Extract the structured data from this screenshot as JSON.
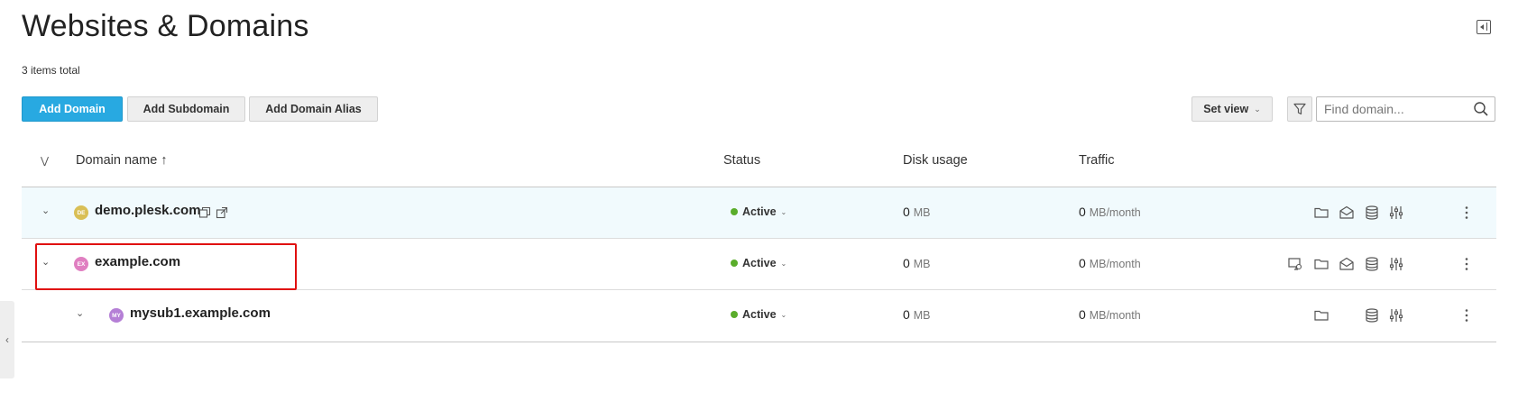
{
  "page": {
    "title": "Websites & Domains",
    "items_total": "3 items total"
  },
  "toolbar": {
    "add_domain": "Add Domain",
    "add_subdomain": "Add Subdomain",
    "add_domain_alias": "Add Domain Alias",
    "set_view": "Set view",
    "search_placeholder": "Find domain..."
  },
  "table": {
    "columns": {
      "domain_name": "Domain name ↑",
      "status": "Status",
      "disk_usage": "Disk usage",
      "traffic": "Traffic"
    },
    "rows": [
      {
        "favicon": "DE",
        "favicon_color": "#d9bf56",
        "name": "demo.plesk.com",
        "status": "Active",
        "disk_value": "0",
        "disk_unit": "MB",
        "traffic_value": "0",
        "traffic_unit": "MB/month",
        "icons": [
          "copy-icon",
          "open-external-icon",
          "folder-icon",
          "mail-icon",
          "database-icon",
          "settings-sliders-icon",
          "more-icon"
        ]
      },
      {
        "favicon": "EX",
        "favicon_color": "#e07fc1",
        "name": "example.com",
        "status": "Active",
        "disk_value": "0",
        "disk_unit": "MB",
        "traffic_value": "0",
        "traffic_unit": "MB/month",
        "icons": [
          "preview-icon",
          "folder-icon",
          "mail-icon",
          "database-icon",
          "settings-sliders-icon",
          "more-icon"
        ]
      },
      {
        "favicon": "MY",
        "favicon_color": "#b57fd6",
        "name": "mysub1.example.com",
        "status": "Active",
        "disk_value": "0",
        "disk_unit": "MB",
        "traffic_value": "0",
        "traffic_unit": "MB/month",
        "icons": [
          "folder-icon",
          "database-icon",
          "settings-sliders-icon",
          "more-icon"
        ]
      }
    ]
  },
  "colors": {
    "primary_button": "#28a9e1",
    "active_dot": "#5aad2b",
    "row_highlight": "#f1fafd",
    "annotation_box": "#e01010"
  }
}
